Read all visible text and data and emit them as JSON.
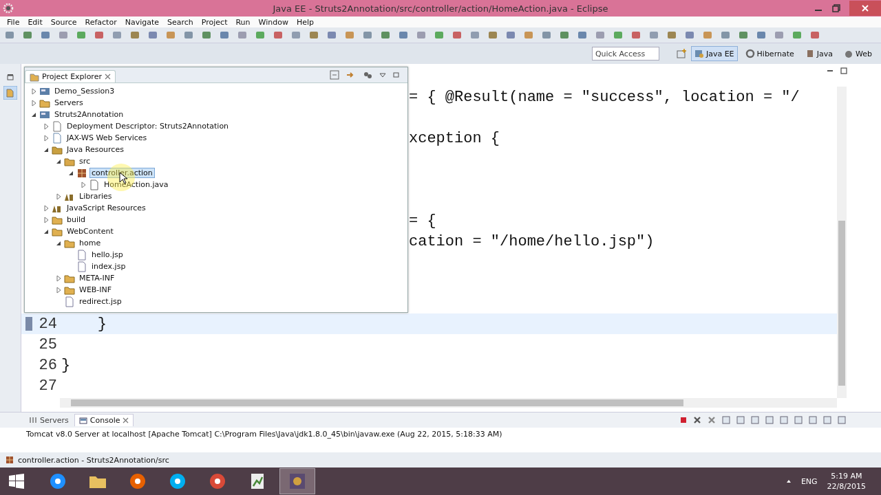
{
  "window": {
    "title": "Java EE - Struts2Annotation/src/controller/action/HomeAction.java - Eclipse"
  },
  "menu": [
    "File",
    "Edit",
    "Source",
    "Refactor",
    "Navigate",
    "Search",
    "Project",
    "Run",
    "Window",
    "Help"
  ],
  "quick_access": {
    "placeholder": "Quick Access"
  },
  "perspectives": [
    {
      "label": "Java EE",
      "kind": "javaee",
      "selected": true
    },
    {
      "label": "Hibernate",
      "kind": "hibernate",
      "selected": false
    },
    {
      "label": "Java",
      "kind": "java",
      "selected": false
    },
    {
      "label": "Web",
      "kind": "web",
      "selected": false
    }
  ],
  "project_explorer": {
    "title": "Project Explorer",
    "tree": [
      {
        "label": "Demo_Session3",
        "kind": "project",
        "expanded": false,
        "selected": false
      },
      {
        "label": "Servers",
        "kind": "folder",
        "expanded": false,
        "selected": false
      },
      {
        "label": "Struts2Annotation",
        "kind": "project",
        "expanded": true,
        "selected": false,
        "children": [
          {
            "label": "Deployment Descriptor: Struts2Annotation",
            "kind": "descriptor",
            "expanded": false,
            "selected": false
          },
          {
            "label": "JAX-WS Web Services",
            "kind": "webservice",
            "expanded": false,
            "selected": false
          },
          {
            "label": "Java Resources",
            "kind": "resources",
            "expanded": true,
            "selected": false,
            "children": [
              {
                "label": "src",
                "kind": "srcfolder",
                "expanded": true,
                "selected": false,
                "children": [
                  {
                    "label": "controller.action",
                    "kind": "package",
                    "expanded": true,
                    "selected": true,
                    "children": [
                      {
                        "label": "HomeAction.java",
                        "kind": "javafile",
                        "expanded": false,
                        "selected": false
                      }
                    ]
                  }
                ]
              },
              {
                "label": "Libraries",
                "kind": "library",
                "expanded": false,
                "selected": false
              }
            ]
          },
          {
            "label": "JavaScript Resources",
            "kind": "library",
            "expanded": false,
            "selected": false
          },
          {
            "label": "build",
            "kind": "folder",
            "expanded": false,
            "selected": false
          },
          {
            "label": "WebContent",
            "kind": "folder",
            "expanded": true,
            "selected": false,
            "children": [
              {
                "label": "home",
                "kind": "folder",
                "expanded": true,
                "selected": false,
                "children": [
                  {
                    "label": "hello.jsp",
                    "kind": "jspfile",
                    "selected": false
                  },
                  {
                    "label": "index.jsp",
                    "kind": "jspfile",
                    "selected": false
                  }
                ]
              },
              {
                "label": "META-INF",
                "kind": "folder",
                "expanded": false,
                "selected": false
              },
              {
                "label": "WEB-INF",
                "kind": "folder",
                "expanded": false,
                "selected": false
              },
              {
                "label": "redirect.jsp",
                "kind": "jspfile",
                "selected": false
              }
            ]
          }
        ]
      }
    ]
  },
  "editor": {
    "lines": [
      {
        "kind": "partial",
        "text": "= { @Result(name = \"success\", location = \"/"
      },
      {
        "kind": "partial"
      },
      {
        "kind": "partial",
        "text": "xception {"
      },
      {
        "kind": "partial"
      },
      {
        "kind": "partial"
      },
      {
        "kind": "partial"
      },
      {
        "kind": "partial",
        "text": "= {"
      },
      {
        "kind": "partial",
        "text": "cation = \"/home/hello.jsp\")"
      },
      {
        "kind": "partial"
      },
      {
        "kind": "partial"
      },
      {
        "kind": "partial"
      },
      {
        "kind": "full",
        "number": "24",
        "text": "    }",
        "current": true
      },
      {
        "kind": "full",
        "number": "25",
        "current": false
      },
      {
        "kind": "full",
        "number": "26",
        "text": "}",
        "current": false
      },
      {
        "kind": "full",
        "number": "27",
        "current": false
      }
    ]
  },
  "bottom_panel": {
    "tabs": [
      {
        "label": "Servers",
        "kind": "servers",
        "selected": false
      },
      {
        "label": "Console",
        "kind": "console",
        "selected": true
      }
    ],
    "console_text": "Tomcat v8.0 Server at localhost [Apache Tomcat] C:\\Program Files\\Java\\jdk1.8.0_45\\bin\\javaw.exe (Aug 22, 2015, 5:18:33 AM)"
  },
  "status_bar": {
    "text": "controller.action - Struts2Annotation/src"
  },
  "taskbar": {
    "apps": [
      {
        "kind": "browser",
        "selected": false
      },
      {
        "kind": "files",
        "selected": false
      },
      {
        "kind": "fox",
        "selected": false
      },
      {
        "kind": "chat",
        "selected": false
      },
      {
        "kind": "chrome",
        "selected": false
      },
      {
        "kind": "chart",
        "selected": false
      },
      {
        "kind": "ide",
        "selected": true
      }
    ],
    "language": "ENG",
    "time": "5:19 AM",
    "date": "22/8/2015"
  }
}
